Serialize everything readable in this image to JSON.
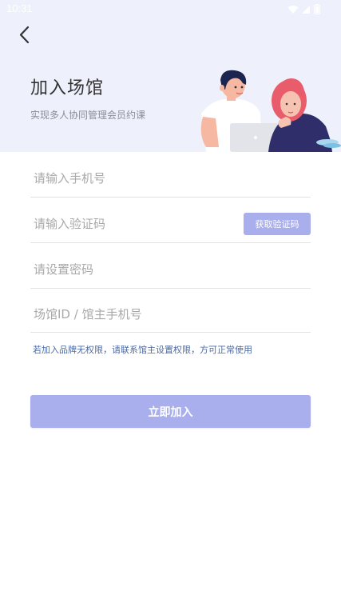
{
  "status_bar": {
    "time": "10:31",
    "icons": [
      "wifi-icon",
      "signal-icon",
      "battery-icon"
    ]
  },
  "header": {
    "back_icon": "chevron-left-icon",
    "title": "加入场馆",
    "subtitle": "实现多人协同管理会员约课",
    "illustration": "two-people-with-laptop-illustration"
  },
  "form": {
    "phone_placeholder": "请输入手机号",
    "code_placeholder": "请输入验证码",
    "get_code_label": "获取验证码",
    "password_placeholder": "请设置密码",
    "venue_placeholder": "场馆ID / 馆主手机号",
    "hint": "若加入品牌无权限，请联系馆主设置权限，方可正常使用",
    "submit_label": "立即加入"
  },
  "colors": {
    "header_background": "#eef0fb",
    "accent": "#a9aeec",
    "hint_text": "#4a6aa8"
  }
}
